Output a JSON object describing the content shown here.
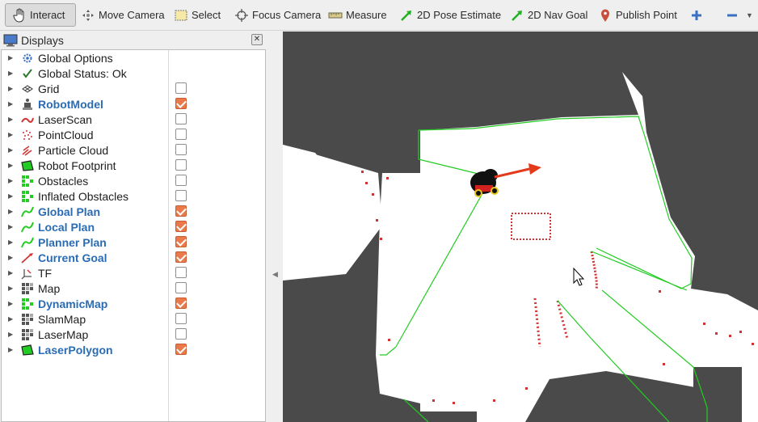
{
  "toolbar": {
    "interact": "Interact",
    "move_camera": "Move Camera",
    "select": "Select",
    "focus_camera": "Focus Camera",
    "measure": "Measure",
    "pose_estimate": "2D Pose Estimate",
    "nav_goal": "2D Nav Goal",
    "publish_point": "Publish Point"
  },
  "displays": {
    "title": "Displays",
    "items": [
      {
        "label": "Global Options",
        "icon": "gear-icon",
        "checkbox": null
      },
      {
        "label": "Global Status: Ok",
        "icon": "check-icon",
        "checkbox": null
      },
      {
        "label": "Grid",
        "icon": "grid-icon",
        "checkbox": false
      },
      {
        "label": "RobotModel",
        "icon": "robot-icon",
        "checkbox": true
      },
      {
        "label": "LaserScan",
        "icon": "laser-scan-icon",
        "checkbox": false
      },
      {
        "label": "PointCloud",
        "icon": "point-cloud-icon",
        "checkbox": false
      },
      {
        "label": "Particle Cloud",
        "icon": "particle-cloud-icon",
        "checkbox": false
      },
      {
        "label": "Robot Footprint",
        "icon": "polygon-icon",
        "checkbox": false
      },
      {
        "label": "Obstacles",
        "icon": "grid-cells-icon",
        "checkbox": false
      },
      {
        "label": "Inflated Obstacles",
        "icon": "grid-cells-icon",
        "checkbox": false
      },
      {
        "label": "Global Plan",
        "icon": "path-icon",
        "checkbox": true
      },
      {
        "label": "Local Plan",
        "icon": "path-icon",
        "checkbox": true
      },
      {
        "label": "Planner Plan",
        "icon": "path-icon",
        "checkbox": true
      },
      {
        "label": "Current Goal",
        "icon": "pose-icon",
        "checkbox": true
      },
      {
        "label": "TF",
        "icon": "tf-icon",
        "checkbox": false
      },
      {
        "label": "Map",
        "icon": "map-icon",
        "checkbox": false
      },
      {
        "label": "DynamicMap",
        "icon": "grid-cells-icon",
        "checkbox": true
      },
      {
        "label": "SlamMap",
        "icon": "map-icon",
        "checkbox": false
      },
      {
        "label": "LaserMap",
        "icon": "map-icon",
        "checkbox": false
      },
      {
        "label": "LaserPolygon",
        "icon": "polygon-icon",
        "checkbox": true
      }
    ]
  },
  "colors": {
    "enabled_label": "#2a6cb4",
    "checkbox_on": "#e87a4b",
    "map_unknown": "#4a4a4a",
    "map_free": "#ffffff",
    "path": "#22cc22",
    "obstacle": "#d23232",
    "robot_arrow": "#e23a1a"
  }
}
